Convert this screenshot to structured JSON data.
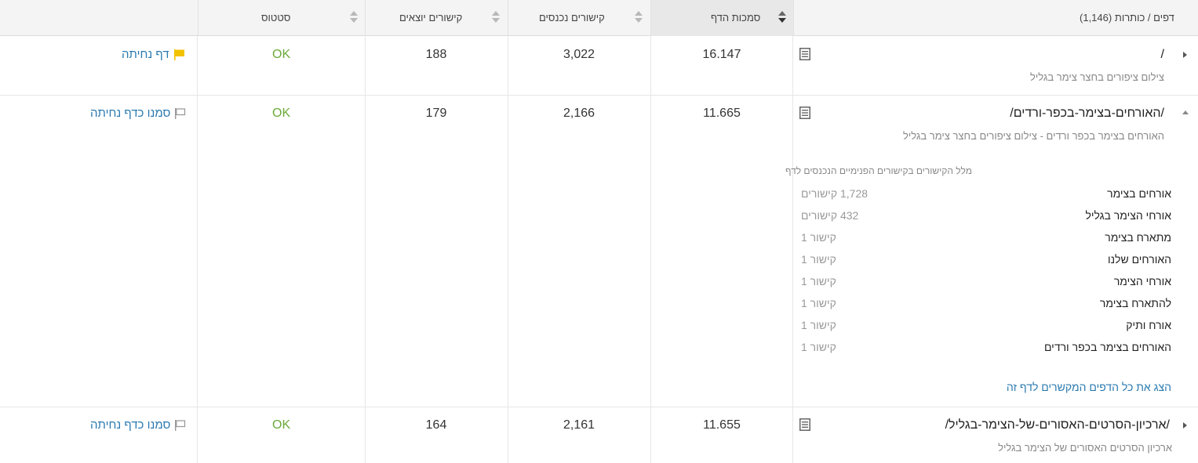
{
  "header": {
    "pages_title": "דפים / כותרות (1,146)",
    "authority": "סמכות הדף",
    "incoming": "קישורים נכנסים",
    "outgoing": "קישורים יוצאים",
    "status": "סטטוס"
  },
  "rows": [
    {
      "url": "/",
      "title": "צילום ציפורים בחצר צימר בגליל",
      "authority": "16.147",
      "incoming": "3,022",
      "outgoing": "188",
      "status": "OK",
      "landing": "דף נחיתה",
      "landing_flag": "filled",
      "expanded": false
    },
    {
      "url": "/האורחים-בצימר-בכפר-ורדים/",
      "title": "האורחים בצימר בכפר ורדים - צילום ציפורים בחצר צימר בגליל",
      "authority": "11.665",
      "incoming": "2,166",
      "outgoing": "179",
      "status": "OK",
      "landing": "סמנו כדף נחיתה",
      "landing_flag": "outline",
      "expanded": true,
      "anchors_title": "מלל הקישורים בקישורים הפנימיים הנכנסים לדף",
      "anchors": [
        {
          "text": "אורחים בצימר",
          "count": "1,728 קישורים"
        },
        {
          "text": "אורחי הצימר בגליל",
          "count": "432 קישורים"
        },
        {
          "text": "מתארח בצימר",
          "count": "קישור 1"
        },
        {
          "text": "האורחים שלנו",
          "count": "קישור 1"
        },
        {
          "text": "אורחי הצימר",
          "count": "קישור 1"
        },
        {
          "text": "להתארח בצימר",
          "count": "קישור 1"
        },
        {
          "text": "אורח ותיק",
          "count": "קישור 1"
        },
        {
          "text": "האורחים בצימר בכפר ורדים",
          "count": "קישור 1"
        }
      ],
      "show_all": "הצג את כל הדפים המקשרים לדף זה"
    },
    {
      "url": "/ארכיון-הסרטים-האסורים-של-הצימר-בגליל/",
      "title": "ארכיון הסרטים האסורים של הצימר בגליל",
      "authority": "11.655",
      "incoming": "2,161",
      "outgoing": "164",
      "status": "OK",
      "landing": "סמנו כדף נחיתה",
      "landing_flag": "outline",
      "expanded": false
    }
  ],
  "colors": {
    "link": "#2a7ab0",
    "ok": "#6aaa3a",
    "flag_filled": "#f2c200"
  },
  "icons": {
    "doc": "document-icon",
    "flag_filled": "flag-filled-icon",
    "flag_outline": "flag-outline-icon"
  }
}
